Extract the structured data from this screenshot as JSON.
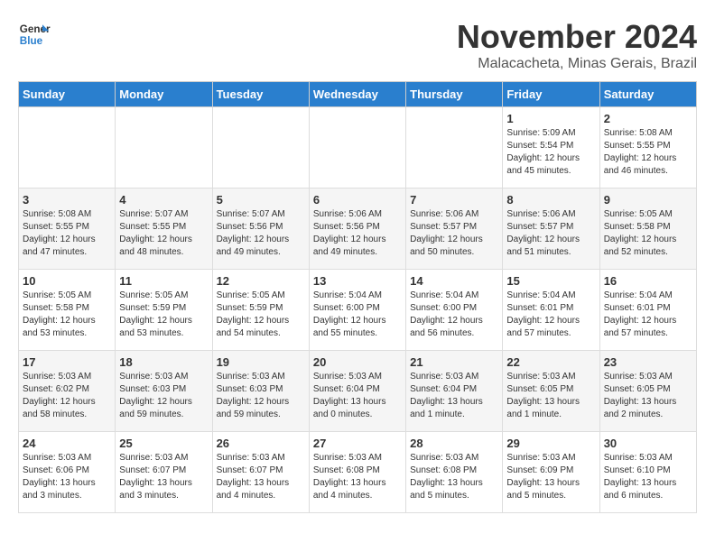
{
  "logo": {
    "line1": "General",
    "line2": "Blue"
  },
  "title": "November 2024",
  "location": "Malacacheta, Minas Gerais, Brazil",
  "weekdays": [
    "Sunday",
    "Monday",
    "Tuesday",
    "Wednesday",
    "Thursday",
    "Friday",
    "Saturday"
  ],
  "weeks": [
    [
      {
        "day": "",
        "info": ""
      },
      {
        "day": "",
        "info": ""
      },
      {
        "day": "",
        "info": ""
      },
      {
        "day": "",
        "info": ""
      },
      {
        "day": "",
        "info": ""
      },
      {
        "day": "1",
        "info": "Sunrise: 5:09 AM\nSunset: 5:54 PM\nDaylight: 12 hours and 45 minutes."
      },
      {
        "day": "2",
        "info": "Sunrise: 5:08 AM\nSunset: 5:55 PM\nDaylight: 12 hours and 46 minutes."
      }
    ],
    [
      {
        "day": "3",
        "info": "Sunrise: 5:08 AM\nSunset: 5:55 PM\nDaylight: 12 hours and 47 minutes."
      },
      {
        "day": "4",
        "info": "Sunrise: 5:07 AM\nSunset: 5:55 PM\nDaylight: 12 hours and 48 minutes."
      },
      {
        "day": "5",
        "info": "Sunrise: 5:07 AM\nSunset: 5:56 PM\nDaylight: 12 hours and 49 minutes."
      },
      {
        "day": "6",
        "info": "Sunrise: 5:06 AM\nSunset: 5:56 PM\nDaylight: 12 hours and 49 minutes."
      },
      {
        "day": "7",
        "info": "Sunrise: 5:06 AM\nSunset: 5:57 PM\nDaylight: 12 hours and 50 minutes."
      },
      {
        "day": "8",
        "info": "Sunrise: 5:06 AM\nSunset: 5:57 PM\nDaylight: 12 hours and 51 minutes."
      },
      {
        "day": "9",
        "info": "Sunrise: 5:05 AM\nSunset: 5:58 PM\nDaylight: 12 hours and 52 minutes."
      }
    ],
    [
      {
        "day": "10",
        "info": "Sunrise: 5:05 AM\nSunset: 5:58 PM\nDaylight: 12 hours and 53 minutes."
      },
      {
        "day": "11",
        "info": "Sunrise: 5:05 AM\nSunset: 5:59 PM\nDaylight: 12 hours and 53 minutes."
      },
      {
        "day": "12",
        "info": "Sunrise: 5:05 AM\nSunset: 5:59 PM\nDaylight: 12 hours and 54 minutes."
      },
      {
        "day": "13",
        "info": "Sunrise: 5:04 AM\nSunset: 6:00 PM\nDaylight: 12 hours and 55 minutes."
      },
      {
        "day": "14",
        "info": "Sunrise: 5:04 AM\nSunset: 6:00 PM\nDaylight: 12 hours and 56 minutes."
      },
      {
        "day": "15",
        "info": "Sunrise: 5:04 AM\nSunset: 6:01 PM\nDaylight: 12 hours and 57 minutes."
      },
      {
        "day": "16",
        "info": "Sunrise: 5:04 AM\nSunset: 6:01 PM\nDaylight: 12 hours and 57 minutes."
      }
    ],
    [
      {
        "day": "17",
        "info": "Sunrise: 5:03 AM\nSunset: 6:02 PM\nDaylight: 12 hours and 58 minutes."
      },
      {
        "day": "18",
        "info": "Sunrise: 5:03 AM\nSunset: 6:03 PM\nDaylight: 12 hours and 59 minutes."
      },
      {
        "day": "19",
        "info": "Sunrise: 5:03 AM\nSunset: 6:03 PM\nDaylight: 12 hours and 59 minutes."
      },
      {
        "day": "20",
        "info": "Sunrise: 5:03 AM\nSunset: 6:04 PM\nDaylight: 13 hours and 0 minutes."
      },
      {
        "day": "21",
        "info": "Sunrise: 5:03 AM\nSunset: 6:04 PM\nDaylight: 13 hours and 1 minute."
      },
      {
        "day": "22",
        "info": "Sunrise: 5:03 AM\nSunset: 6:05 PM\nDaylight: 13 hours and 1 minute."
      },
      {
        "day": "23",
        "info": "Sunrise: 5:03 AM\nSunset: 6:05 PM\nDaylight: 13 hours and 2 minutes."
      }
    ],
    [
      {
        "day": "24",
        "info": "Sunrise: 5:03 AM\nSunset: 6:06 PM\nDaylight: 13 hours and 3 minutes."
      },
      {
        "day": "25",
        "info": "Sunrise: 5:03 AM\nSunset: 6:07 PM\nDaylight: 13 hours and 3 minutes."
      },
      {
        "day": "26",
        "info": "Sunrise: 5:03 AM\nSunset: 6:07 PM\nDaylight: 13 hours and 4 minutes."
      },
      {
        "day": "27",
        "info": "Sunrise: 5:03 AM\nSunset: 6:08 PM\nDaylight: 13 hours and 4 minutes."
      },
      {
        "day": "28",
        "info": "Sunrise: 5:03 AM\nSunset: 6:08 PM\nDaylight: 13 hours and 5 minutes."
      },
      {
        "day": "29",
        "info": "Sunrise: 5:03 AM\nSunset: 6:09 PM\nDaylight: 13 hours and 5 minutes."
      },
      {
        "day": "30",
        "info": "Sunrise: 5:03 AM\nSunset: 6:10 PM\nDaylight: 13 hours and 6 minutes."
      }
    ]
  ]
}
